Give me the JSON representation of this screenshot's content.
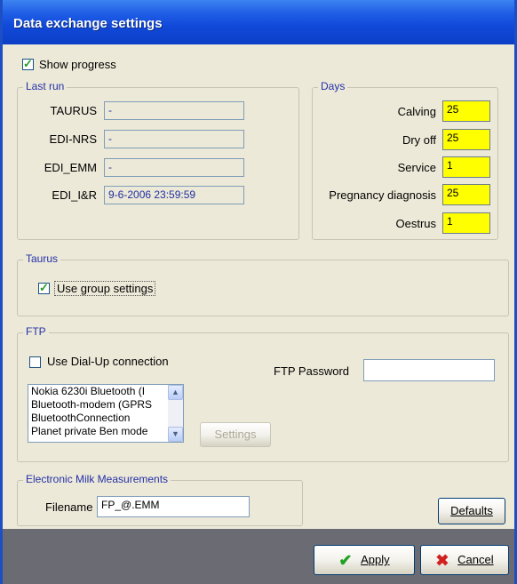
{
  "window": {
    "title": "Data exchange settings"
  },
  "show_progress": {
    "label": "Show progress",
    "checked": true
  },
  "last_run": {
    "legend": "Last run",
    "rows": [
      {
        "label": "TAURUS",
        "value": "-"
      },
      {
        "label": "EDI-NRS",
        "value": "-"
      },
      {
        "label": "EDI_EMM",
        "value": "-"
      },
      {
        "label": "EDI_I&R",
        "value": "9-6-2006 23:59:59"
      }
    ]
  },
  "days": {
    "legend": "Days",
    "rows": [
      {
        "label": "Calving",
        "value": "25"
      },
      {
        "label": "Dry off",
        "value": "25"
      },
      {
        "label": "Service",
        "value": "1"
      },
      {
        "label": "Pregnancy diagnosis",
        "value": "25"
      },
      {
        "label": "Oestrus",
        "value": "1"
      }
    ]
  },
  "taurus": {
    "legend": "Taurus",
    "use_group_settings": {
      "label": "Use group settings",
      "checked": true
    }
  },
  "ftp": {
    "legend": "FTP",
    "dialup": {
      "label": "Use Dial-Up connection",
      "checked": false
    },
    "password_label": "FTP Password",
    "password_value": "",
    "connections": [
      "Nokia 6230i Bluetooth (I",
      "Bluetooth-modem (GPRS",
      "BluetoothConnection",
      "Planet private Ben mode"
    ],
    "settings_label": "Settings"
  },
  "emm": {
    "legend": "Electronic Milk Measurements",
    "filename_label": "Filename",
    "filename_value": "FP_@.EMM"
  },
  "buttons": {
    "defaults": "Defaults",
    "apply": "Apply",
    "cancel": "Cancel"
  },
  "colors": {
    "title_bar": "#1048d8",
    "highlight_yellow": "#ffff00",
    "legend_text": "#2430a8",
    "apply_check": "#21a121",
    "cancel_x": "#d02020"
  }
}
